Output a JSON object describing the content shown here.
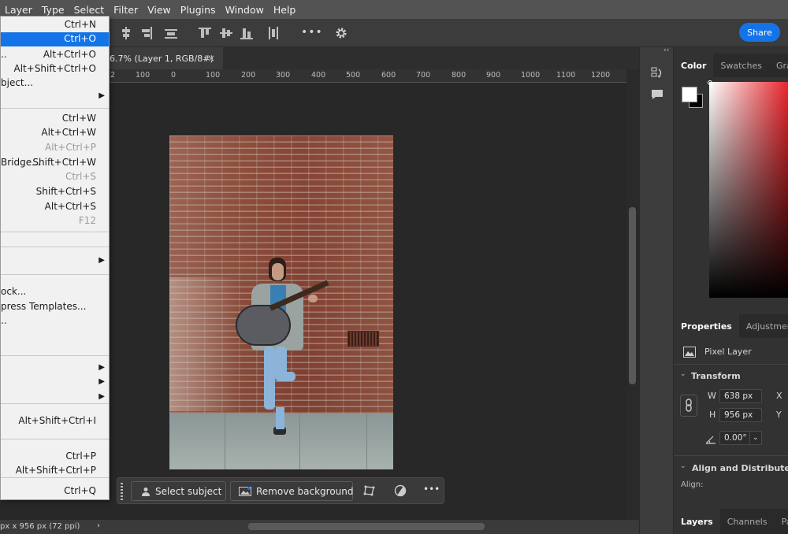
{
  "menubar": [
    "Layer",
    "Type",
    "Select",
    "Filter",
    "View",
    "Plugins",
    "Window",
    "Help"
  ],
  "share_label": "Share",
  "doc_tab": {
    "title": "6.7% (Layer 1, RGB/8#)",
    "close": "×"
  },
  "ruler_labels": [
    "2",
    "100",
    "0",
    "100",
    "200",
    "300",
    "400",
    "500",
    "600",
    "700",
    "800",
    "900",
    "1000",
    "1100",
    "1200"
  ],
  "menu_items": [
    {
      "label": "",
      "shortcut": "Ctrl+N",
      "disabled": false,
      "selected": false
    },
    {
      "label": "",
      "shortcut": "Ctrl+O",
      "disabled": false,
      "selected": true
    },
    {
      "label": "..",
      "shortcut": "Alt+Ctrl+O",
      "disabled": false,
      "selected": false
    },
    {
      "label": "",
      "shortcut": "Alt+Shift+Ctrl+O",
      "disabled": false,
      "selected": false
    },
    {
      "label": "bject...",
      "shortcut": "",
      "disabled": false,
      "selected": false
    },
    {
      "label": "",
      "shortcut": "",
      "disabled": false,
      "selected": false,
      "submenu": true
    },
    {
      "label": "",
      "shortcut": "Ctrl+W",
      "disabled": false,
      "selected": false
    },
    {
      "label": "",
      "shortcut": "Alt+Ctrl+W",
      "disabled": false,
      "selected": false
    },
    {
      "label": "",
      "shortcut": "Alt+Ctrl+P",
      "disabled": true,
      "selected": false
    },
    {
      "label": "Bridge...",
      "shortcut": "Shift+Ctrl+W",
      "disabled": false,
      "selected": false
    },
    {
      "label": "",
      "shortcut": "Ctrl+S",
      "disabled": true,
      "selected": false
    },
    {
      "label": "",
      "shortcut": "Shift+Ctrl+S",
      "disabled": false,
      "selected": false
    },
    {
      "label": "",
      "shortcut": "Alt+Ctrl+S",
      "disabled": false,
      "selected": false
    },
    {
      "label": "",
      "shortcut": "F12",
      "disabled": true,
      "selected": false
    },
    {
      "label": "",
      "shortcut": "",
      "disabled": false,
      "selected": false,
      "submenu": true
    },
    {
      "label": "ock...",
      "shortcut": "",
      "disabled": false,
      "selected": false
    },
    {
      "label": "press Templates...",
      "shortcut": "",
      "disabled": false,
      "selected": false
    },
    {
      "label": "..",
      "shortcut": "",
      "disabled": false,
      "selected": false
    },
    {
      "label": "",
      "shortcut": "",
      "disabled": false,
      "selected": false,
      "submenu": true
    },
    {
      "label": "",
      "shortcut": "",
      "disabled": false,
      "selected": false,
      "submenu": true
    },
    {
      "label": "",
      "shortcut": "",
      "disabled": false,
      "selected": false,
      "submenu": true
    },
    {
      "label": "",
      "shortcut": "Alt+Shift+Ctrl+I",
      "disabled": false,
      "selected": false
    },
    {
      "label": "",
      "shortcut": "Ctrl+P",
      "disabled": false,
      "selected": false
    },
    {
      "label": "",
      "shortcut": "Alt+Shift+Ctrl+P",
      "disabled": false,
      "selected": false
    },
    {
      "label": "",
      "shortcut": "Ctrl+Q",
      "disabled": false,
      "selected": false
    }
  ],
  "context_bar": {
    "select_subject": "Select subject",
    "remove_background": "Remove background",
    "more": "•••"
  },
  "status": {
    "text": "px x 956 px (72 ppi)",
    "arrow": "›"
  },
  "panels": {
    "color_tabs": [
      "Color",
      "Swatches",
      "Gradier"
    ],
    "properties_tabs": [
      "Properties",
      "Adjustments"
    ],
    "pixel_layer": "Pixel Layer",
    "transform": "Transform",
    "w_label": "W",
    "w_value": "638 px",
    "h_label": "H",
    "h_value": "956 px",
    "x_label": "X",
    "y_label": "Y",
    "angle_value": "0.00°",
    "align_distribute": "Align and Distribute",
    "align_label": "Align:",
    "layers_tabs": [
      "Layers",
      "Channels",
      "Paths"
    ],
    "collapse": "‹‹"
  },
  "colors": {
    "accent": "#1473e6",
    "menu_bg": "#f1f1f1",
    "app_bg": "#282828"
  }
}
